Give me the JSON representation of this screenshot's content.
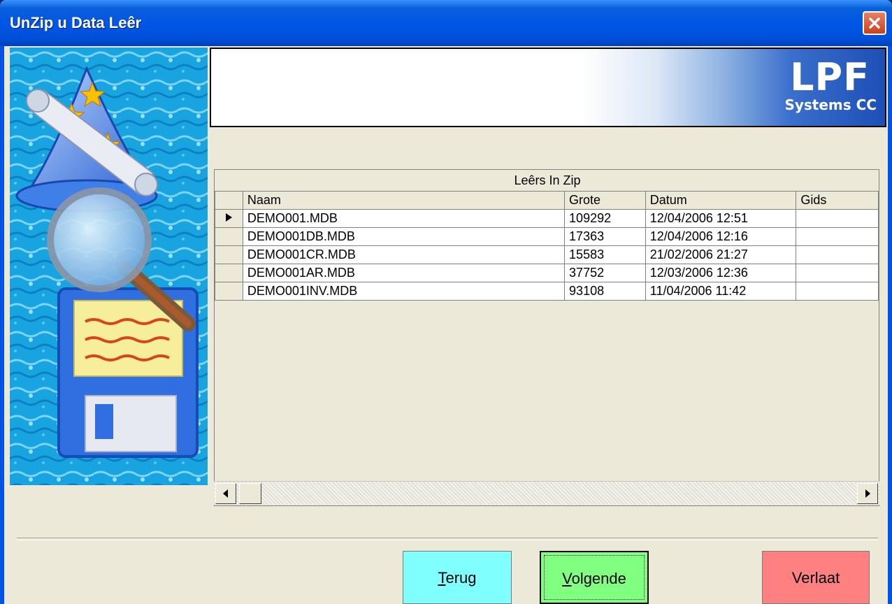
{
  "window": {
    "title": "UnZip u Data Leêr"
  },
  "banner": {
    "logo_main": "LPF",
    "logo_sub": "Systems CC"
  },
  "grid": {
    "caption": "Leêrs In Zip",
    "columns": [
      "Naam",
      "Grote",
      "Datum",
      "Gids"
    ],
    "rows": [
      {
        "naam": "DEMO001.MDB",
        "grote": "109292",
        "datum": "12/04/2006 12:51",
        "gids": ""
      },
      {
        "naam": "DEMO001DB.MDB",
        "grote": "17363",
        "datum": "12/04/2006 12:16",
        "gids": ""
      },
      {
        "naam": "DEMO001CR.MDB",
        "grote": "15583",
        "datum": "21/02/2006 21:27",
        "gids": ""
      },
      {
        "naam": "DEMO001AR.MDB",
        "grote": "37752",
        "datum": "12/03/2006 12:36",
        "gids": ""
      },
      {
        "naam": "DEMO001INV.MDB",
        "grote": "93108",
        "datum": "11/04/2006 11:42",
        "gids": ""
      }
    ],
    "selected_row": 0
  },
  "buttons": {
    "back": {
      "label_first": "T",
      "label_rest": "erug",
      "color": "#80ffff"
    },
    "next": {
      "label_first": "V",
      "label_rest": "olgende",
      "color": "#80ff80"
    },
    "exit": {
      "label": "Verlaat",
      "color": "#ff8080"
    }
  },
  "icons": {
    "close": "close-icon",
    "scroll_left": "arrow-left-icon",
    "scroll_right": "arrow-right-icon",
    "row_indicator": "row-pointer-icon",
    "wizard": "wizard-hat-magnifier-floppy-icon"
  },
  "colors": {
    "titlebar": "#0054e3",
    "client": "#ece9d8"
  }
}
